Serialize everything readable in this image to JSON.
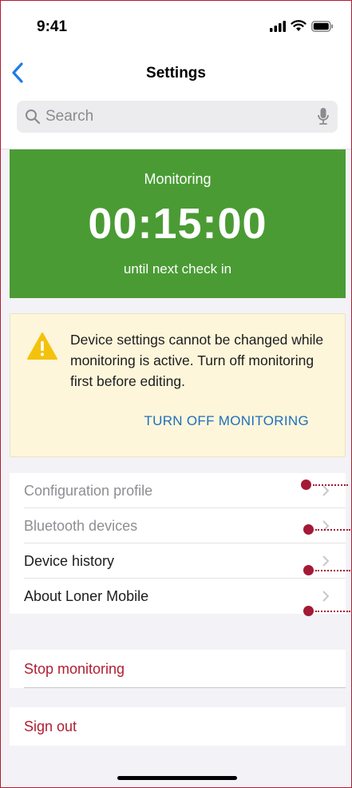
{
  "status_bar": {
    "time": "9:41"
  },
  "nav": {
    "title": "Settings"
  },
  "search": {
    "placeholder": "Search"
  },
  "monitoring": {
    "label": "Monitoring",
    "time": "00:15:00",
    "subtitle": "until next check in"
  },
  "warning": {
    "message": "Device settings cannot be changed while monitoring is active. Turn off monitoring first before editing.",
    "action_label": "TURN OFF MONITORING"
  },
  "settings_list": {
    "items": [
      {
        "label": "Configuration profile",
        "enabled": false
      },
      {
        "label": "Bluetooth devices",
        "enabled": false
      },
      {
        "label": "Device history",
        "enabled": true
      },
      {
        "label": "About Loner Mobile",
        "enabled": true
      }
    ]
  },
  "actions": {
    "stop_label": "Stop monitoring",
    "signout_label": "Sign out"
  },
  "colors": {
    "accent": "#b01e33",
    "monitor_green": "#4a9b34",
    "link_blue": "#1e6fbf",
    "warning_bg": "#fdf6da"
  }
}
